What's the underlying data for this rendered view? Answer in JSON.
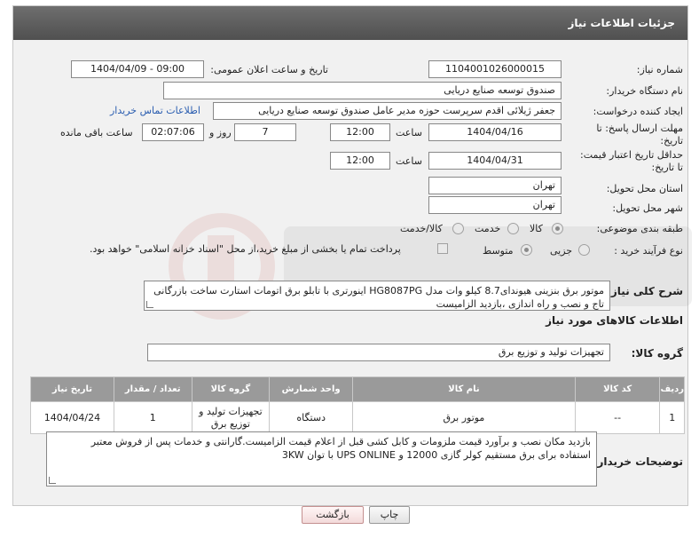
{
  "header": {
    "title": "جزئیات اطلاعات نیاز"
  },
  "fields": {
    "need_number_label": "شماره نیاز:",
    "need_number": "1104001026000015",
    "announce_label": "تاریخ و ساعت اعلان عمومی:",
    "announce_value": "1404/04/09 - 09:00",
    "buyer_org_label": "نام دستگاه خریدار:",
    "buyer_org": "صندوق توسعه صنایع دریایی",
    "requester_label": "ایجاد کننده درخواست:",
    "requester": "جعفر ژیلائی اقدم سرپرست حوزه مدیر عامل صندوق توسعه صنایع دریایی",
    "contact_link": "اطلاعات تماس خریدار",
    "deadline_label_1": "مهلت ارسال پاسخ: تا",
    "deadline_label_2": "تاریخ:",
    "deadline_date": "1404/04/16",
    "time_label": "ساعت",
    "deadline_time": "12:00",
    "days_value": "7",
    "days_label": "روز و",
    "remaining_time": "02:07:06",
    "remaining_label": "ساعت باقی مانده",
    "validity_label_1": "حداقل تاریخ اعتبار قیمت:",
    "validity_label_2": "تا تاریخ:",
    "validity_date": "1404/04/31",
    "validity_time": "12:00",
    "province_label": "استان محل تحویل:",
    "province": "تهران",
    "city_label": "شهر محل تحویل:",
    "city": "تهران",
    "category_label": "طبقه بندی موضوعی:",
    "category_options": [
      "کالا",
      "خدمت",
      "کالا/خدمت"
    ],
    "category_selected": "کالا",
    "process_label": "نوع فرآیند خرید :",
    "process_options": [
      "جزیی",
      "متوسط"
    ],
    "process_selected": "متوسط",
    "payment_note": "پرداخت تمام یا بخشی از مبلغ خرید،از محل \"اسناد خزانه اسلامی\" خواهد بود."
  },
  "description": {
    "label": "شرح کلی نیاز:",
    "line1": "موتور برق بنزینی هیوندای8.7 کیلو وات مدل HG8087PG  اینورتری  با تابلو برق اتومات استارت ساخت بازرگانی",
    "line2": "تاج و نصب و راه اندازی ،بازدید الزامیست"
  },
  "goods_section": {
    "title": "اطلاعات کالاهای مورد نیاز",
    "group_label": "گروه کالا:",
    "group_value": "تجهیزات تولید و توزیع برق"
  },
  "table": {
    "headers": [
      "ردیف",
      "کد کالا",
      "نام کالا",
      "واحد شمارش",
      "گروه کالا",
      "تعداد / مقدار",
      "تاریخ نیاز"
    ],
    "rows": [
      {
        "row": "1",
        "code": "--",
        "name": "موتور برق",
        "unit": "دستگاه",
        "group_line1": "تجهیزات تولید و",
        "group_line2": "توزیع برق",
        "qty": "1",
        "date": "1404/04/24"
      }
    ]
  },
  "buyer_notes": {
    "label": "توضیحات خریدار:",
    "line1": "بازدید مکان نصب و برآورد قیمت ملزومات و کابل کشی قبل از اعلام قیمت الزامیست.گارانتی و خدمات پس از فروش معتبر",
    "line2": "استفاده برای برق مستقیم کولر گازی 12000 و UPS ONLINE با توان 3KW"
  },
  "buttons": {
    "print": "چاپ",
    "back": "بازگشت"
  },
  "colors": {
    "header_bg": "#5a5a5a",
    "table_header_bg": "#9a9a9a",
    "link": "#2a5db0",
    "back_button_bg": "#f3dada"
  }
}
